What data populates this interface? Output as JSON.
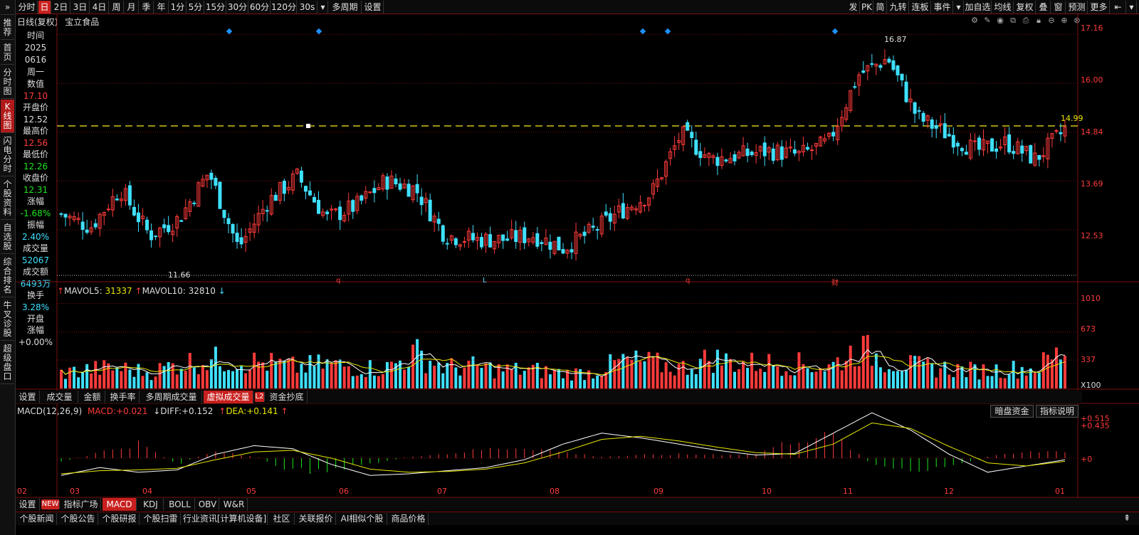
{
  "colors": {
    "up": "#ff3b3b",
    "down": "#3fe0ff",
    "ma5": "#ffffff",
    "ma10": "#e6e600",
    "grid": "#7a1010",
    "bg": "#000000",
    "accent": "#c8201e"
  },
  "topbar": {
    "items": [
      {
        "label": "⇥",
        "icon": "dock-icon"
      },
      {
        "label": "分时"
      },
      {
        "label": "日",
        "active": true
      },
      {
        "label": "2日"
      },
      {
        "label": "3日"
      },
      {
        "label": "4日"
      },
      {
        "label": "周"
      },
      {
        "label": "月"
      },
      {
        "label": "季"
      },
      {
        "label": "年"
      },
      {
        "label": "1分"
      },
      {
        "label": "5分"
      },
      {
        "label": "15分"
      },
      {
        "label": "30分"
      },
      {
        "label": "60分"
      },
      {
        "label": "120分"
      },
      {
        "label": "30s"
      },
      {
        "label": "▾",
        "icon": "dropdown-icon"
      },
      {
        "label": "多周期"
      },
      {
        "label": "设置"
      }
    ],
    "right_items": [
      {
        "label": "发"
      },
      {
        "label": "PK"
      },
      {
        "label": "简"
      },
      {
        "label": "九转"
      },
      {
        "label": "连板"
      },
      {
        "label": "事件"
      },
      {
        "label": "▾",
        "icon": "dropdown-icon"
      },
      {
        "label": "加自选"
      },
      {
        "label": "均线"
      },
      {
        "label": "复权"
      },
      {
        "label": "叠"
      },
      {
        "label": "窗"
      },
      {
        "label": "预测"
      },
      {
        "label": "更多"
      },
      {
        "label": "⇤",
        "icon": "back-icon"
      },
      {
        "label": "▾",
        "icon": "dropdown-icon"
      }
    ]
  },
  "leftnav": [
    {
      "label": "»",
      "icon": "expand-icon"
    },
    {
      "label": "推荐"
    },
    {
      "label": "首页"
    },
    {
      "label": "分时图"
    },
    {
      "label": "K线图",
      "active": true
    },
    {
      "label": "闪电分时"
    },
    {
      "label": "个股资料"
    },
    {
      "label": "自选股"
    },
    {
      "label": "综合排名"
    },
    {
      "label": "牛叉诊股"
    },
    {
      "label": "超级盘口"
    }
  ],
  "main": {
    "title": "日线(复权)",
    "stock": "宝立食品"
  },
  "infopanel": {
    "time_label": "时间",
    "date_year": "2025",
    "date_md": "0616",
    "weekday": "周一",
    "value_label": "数值",
    "value": "17.10",
    "open_label": "开盘价",
    "open": "12.52",
    "high_label": "最高价",
    "high": "12.56",
    "low_label": "最低价",
    "low": "12.26",
    "close_label": "收盘价",
    "close": "12.31",
    "change_label": "涨幅",
    "change": "-1.68%",
    "amp_label": "振幅",
    "amp": "2.40%",
    "vol_label": "成交量",
    "vol": "52067",
    "amt_label": "成交额",
    "amt": "6493万",
    "turnover_label": "换手",
    "turnover": "3.28%",
    "open_change_label1": "开盘",
    "open_change_label2": "涨幅",
    "open_change": "+0.00%"
  },
  "price_axis": {
    "ticks": [
      "17.16",
      "16.00",
      "14.84",
      "13.69",
      "12.53"
    ],
    "current_price_label": "14.99"
  },
  "annotations": {
    "high": "16.87",
    "low": "11.66",
    "event_markers": [
      "q",
      "L",
      "q",
      "财"
    ]
  },
  "volume": {
    "legend_mavol5_label": "MAVOL5:",
    "legend_mavol5": "31337",
    "legend_mavol10_label": "MAVOL10:",
    "legend_mavol10": "32810",
    "ticks": [
      "1010",
      "673",
      "337"
    ],
    "unit": "X100"
  },
  "vol_tabs": [
    {
      "label": "设置"
    },
    {
      "label": "成交量"
    },
    {
      "label": "金额"
    },
    {
      "label": "换手率"
    },
    {
      "label": "多周期成交量"
    },
    {
      "label": "虚拟成交量",
      "active": true
    },
    {
      "label": "L2",
      "badge": true
    },
    {
      "label": "资金抄底"
    }
  ],
  "macd": {
    "title": "MACD(12,26,9)",
    "macd_label": "MACD:",
    "macd_val": "+0.021",
    "diff_label": "DIFF:",
    "diff_val": "+0.152",
    "dea_label": "DEA:",
    "dea_val": "+0.141",
    "ticks": [
      "+0.515",
      "+0.435",
      "+0"
    ],
    "buttons": [
      "暗盘资金",
      "指标说明"
    ]
  },
  "x_axis": [
    "02",
    "03",
    "04",
    "05",
    "06",
    "07",
    "08",
    "09",
    "10",
    "11",
    "12",
    "01"
  ],
  "indicator_tabs": [
    {
      "label": "设置"
    },
    {
      "label": "NEW",
      "badge": true
    },
    {
      "label": "指标广场"
    },
    {
      "label": "MACD",
      "active": true
    },
    {
      "label": "KDJ"
    },
    {
      "label": "BOLL"
    },
    {
      "label": "OBV"
    },
    {
      "label": "W&R"
    }
  ],
  "bottom_links": [
    "个股新闻",
    "个股公告",
    "个股研报",
    "个股扫雷",
    "行业资讯[计算机设备]",
    "社区",
    "关联报价",
    "AI相似个股",
    "商品价格"
  ],
  "chart_data": {
    "type": "candlestick",
    "x_labels": [
      "02",
      "03",
      "04",
      "05",
      "06",
      "07",
      "08",
      "09",
      "10",
      "11",
      "12",
      "01"
    ],
    "ylim": [
      11.4,
      17.3
    ],
    "close_anchors": [
      12.9,
      12.6,
      13.5,
      12.4,
      12.8,
      13.9,
      12.1,
      13.2,
      13.8,
      12.8,
      13.1,
      13.7,
      13.5,
      12.4,
      12.3,
      12.3,
      12.4,
      12.1,
      12.5,
      13.0,
      13.4,
      14.8,
      14.2,
      14.3,
      14.4,
      14.3,
      14.6,
      16.2,
      16.6,
      15.2,
      14.8,
      14.4,
      14.6,
      14.2,
      14.9
    ],
    "volume_values": [
      180,
      230,
      240,
      190,
      300,
      340,
      330,
      300,
      250,
      290,
      250,
      240,
      420,
      250,
      260,
      220,
      220,
      180,
      190,
      330,
      300,
      240,
      360,
      300,
      300,
      290,
      250,
      480,
      330,
      260,
      240,
      210,
      230,
      240,
      460
    ],
    "macd_hist": [
      -0.05,
      0.08,
      0.2,
      -0.08,
      0.1,
      0.03,
      -0.18,
      -0.15,
      -0.08,
      0.02,
      0.06,
      0.12,
      0.15,
      0.08,
      0.02,
      0.04,
      0.05,
      0.05,
      0.06,
      0.25,
      0.3,
      -0.08,
      -0.2,
      -0.12,
      0.02,
      0.08,
      0.1
    ],
    "diff": [
      -0.22,
      -0.12,
      -0.18,
      -0.15,
      0.05,
      0.16,
      0.12,
      -0.08,
      -0.22,
      -0.2,
      -0.16,
      -0.12,
      -0.02,
      0.18,
      0.32,
      0.26,
      0.18,
      0.1,
      0.04,
      0.06,
      0.32,
      0.58,
      0.36,
      0.05,
      -0.18,
      -0.1,
      -0.02
    ],
    "dea": [
      -0.2,
      -0.16,
      -0.15,
      -0.13,
      -0.02,
      0.08,
      0.1,
      0.0,
      -0.14,
      -0.18,
      -0.17,
      -0.14,
      -0.06,
      0.08,
      0.24,
      0.28,
      0.22,
      0.14,
      0.07,
      0.05,
      0.18,
      0.45,
      0.38,
      0.15,
      -0.06,
      -0.1,
      -0.04
    ]
  }
}
